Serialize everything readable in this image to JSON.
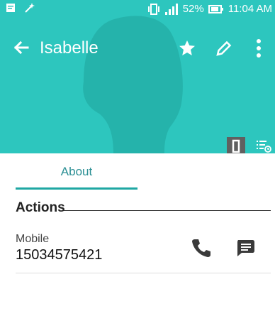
{
  "status": {
    "battery": "52%",
    "time": "11:04 AM",
    "icons": [
      "notification-icon",
      "magic-icon",
      "vibrate-icon",
      "signal-icon",
      "battery-icon"
    ]
  },
  "appbar": {
    "title": "Isabelle",
    "icons": [
      "back-arrow-icon",
      "star-icon",
      "edit-icon",
      "more-icon"
    ]
  },
  "tabs": {
    "about": "About"
  },
  "actions": {
    "title": "Actions",
    "mobile_label": "Mobile",
    "mobile_number": "15034575421"
  },
  "colors": {
    "header": "#2dc6be",
    "accent": "#1fa7a3",
    "text": "#222222"
  }
}
